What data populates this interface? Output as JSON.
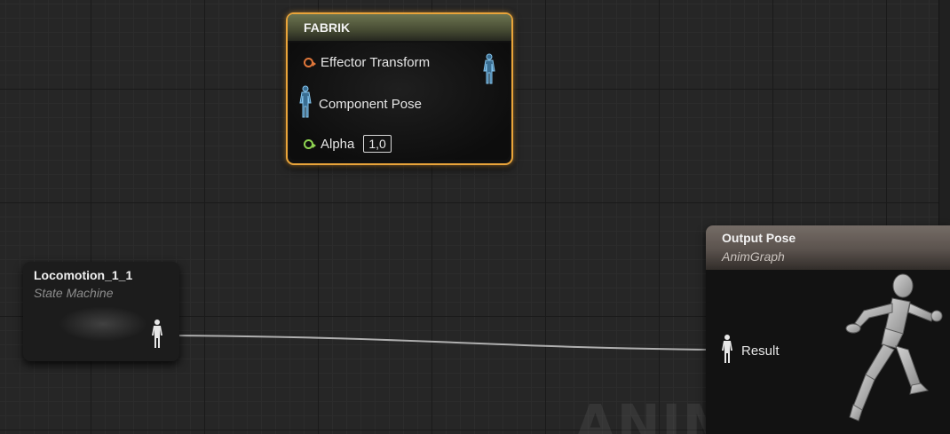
{
  "fabrik_node": {
    "title": "FABRIK",
    "pins": {
      "effector_transform": "Effector Transform",
      "component_pose": "Component Pose",
      "alpha": "Alpha",
      "alpha_value": "1,0"
    }
  },
  "locomotion_node": {
    "title": "Locomotion_1_1",
    "subtitle": "State Machine"
  },
  "output_node": {
    "title": "Output Pose",
    "subtitle": "AnimGraph",
    "result_label": "Result"
  },
  "watermark": "ANIMATION",
  "colors": {
    "selection_outline": "#e9a43a",
    "pin_transform": "#e0773a",
    "pin_float": "#8fd452",
    "pin_pose": "#4da4e0",
    "wire": "#c8c8c8"
  },
  "icons": {
    "pose_pin": "person-silhouette-icon",
    "mannequin": "running-mannequin-icon"
  }
}
